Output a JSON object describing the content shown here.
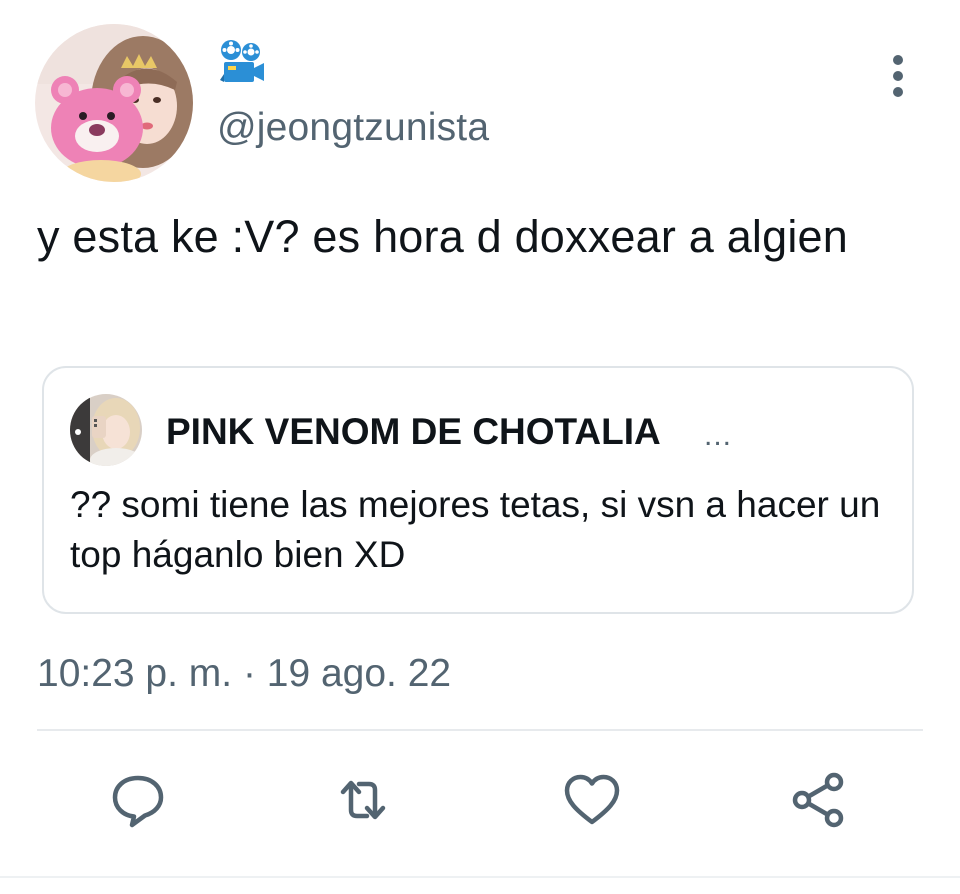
{
  "author": {
    "display_name_emoji": "🎥",
    "handle": "@jeongtzunista",
    "avatar_icon": "profile-photo"
  },
  "tweet": {
    "text": "y esta ke :V? es hora d doxxear a algien"
  },
  "quote": {
    "name": "PINK VENOM DE CHOTALIA",
    "ellipsis": "...",
    "text": "?? somi tiene las mejores tetas, si vsn a hacer un top háganlo bien XD"
  },
  "timestamp": "10:23 p. m. · 19 ago. 22",
  "actions": {
    "reply_icon": "speech-bubble-icon",
    "retweet_icon": "retweet-icon",
    "like_icon": "heart-icon",
    "share_icon": "share-icon"
  },
  "colors": {
    "text_primary": "#0f1419",
    "text_secondary": "#536471",
    "border": "#dfe4e8",
    "icon": "#536471"
  }
}
